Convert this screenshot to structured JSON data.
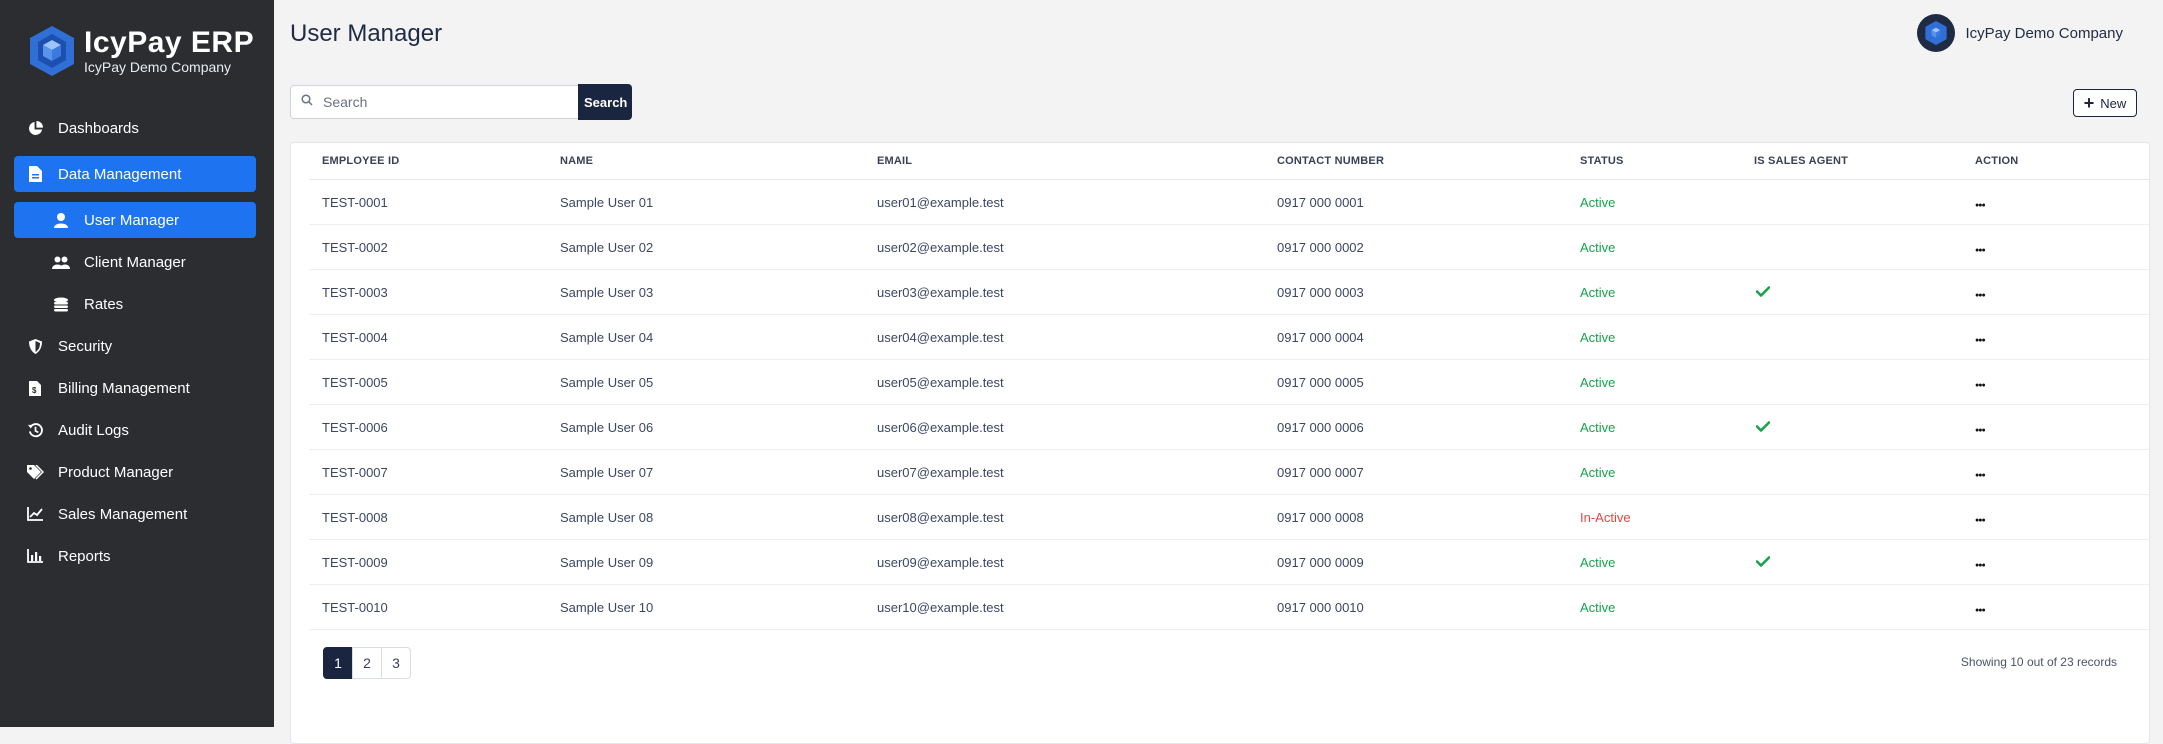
{
  "brand": {
    "title": "IcyPay ERP",
    "subtitle": "IcyPay Demo Company"
  },
  "sidebar": {
    "items": [
      {
        "label": "Dashboards",
        "icon": "pie-chart-icon"
      },
      {
        "label": "Data Management",
        "icon": "document-icon",
        "active": true
      },
      {
        "label": "User Manager",
        "icon": "user-icon",
        "sub": true,
        "active": true
      },
      {
        "label": "Client Manager",
        "icon": "users-icon",
        "sub": true
      },
      {
        "label": "Rates",
        "icon": "coins-icon",
        "sub": true
      },
      {
        "label": "Security",
        "icon": "shield-icon"
      },
      {
        "label": "Billing Management",
        "icon": "invoice-icon"
      },
      {
        "label": "Audit Logs",
        "icon": "history-icon"
      },
      {
        "label": "Product Manager",
        "icon": "tags-icon"
      },
      {
        "label": "Sales Management",
        "icon": "line-chart-icon"
      },
      {
        "label": "Reports",
        "icon": "bar-chart-icon"
      }
    ]
  },
  "header": {
    "title": "User Manager",
    "company": "IcyPay Demo Company"
  },
  "search": {
    "placeholder": "Search",
    "value": "",
    "button_label": "Search"
  },
  "toolbar": {
    "new_label": "New"
  },
  "table": {
    "columns": [
      "EMPLOYEE ID",
      "NAME",
      "EMAIL",
      "CONTACT NUMBER",
      "STATUS",
      "IS SALES AGENT",
      "ACTION"
    ],
    "rows": [
      {
        "id": "TEST-0001",
        "name": "Sample User 01",
        "email": "user01@example.test",
        "contact": "0917 000 0001",
        "status": "Active",
        "sales_agent": false
      },
      {
        "id": "TEST-0002",
        "name": "Sample User 02",
        "email": "user02@example.test",
        "contact": "0917 000 0002",
        "status": "Active",
        "sales_agent": false
      },
      {
        "id": "TEST-0003",
        "name": "Sample User 03",
        "email": "user03@example.test",
        "contact": "0917 000 0003",
        "status": "Active",
        "sales_agent": true
      },
      {
        "id": "TEST-0004",
        "name": "Sample User 04",
        "email": "user04@example.test",
        "contact": "0917 000 0004",
        "status": "Active",
        "sales_agent": false
      },
      {
        "id": "TEST-0005",
        "name": "Sample User 05",
        "email": "user05@example.test",
        "contact": "0917 000 0005",
        "status": "Active",
        "sales_agent": false
      },
      {
        "id": "TEST-0006",
        "name": "Sample User 06",
        "email": "user06@example.test",
        "contact": "0917 000 0006",
        "status": "Active",
        "sales_agent": true
      },
      {
        "id": "TEST-0007",
        "name": "Sample User 07",
        "email": "user07@example.test",
        "contact": "0917 000 0007",
        "status": "Active",
        "sales_agent": false
      },
      {
        "id": "TEST-0008",
        "name": "Sample User 08",
        "email": "user08@example.test",
        "contact": "0917 000 0008",
        "status": "In-Active",
        "sales_agent": false
      },
      {
        "id": "TEST-0009",
        "name": "Sample User 09",
        "email": "user09@example.test",
        "contact": "0917 000 0009",
        "status": "Active",
        "sales_agent": true
      },
      {
        "id": "TEST-0010",
        "name": "Sample User 10",
        "email": "user10@example.test",
        "contact": "0917 000 0010",
        "status": "Active",
        "sales_agent": false
      }
    ]
  },
  "pagination": {
    "pages": [
      "1",
      "2",
      "3"
    ],
    "current": "1",
    "summary": "Showing 10 out of 23 records"
  },
  "colors": {
    "sidebar_bg": "#2b2d31",
    "accent": "#1e74f0",
    "navy": "#1a2540",
    "active_status": "#16a34a",
    "inactive_status": "#ef4444"
  }
}
